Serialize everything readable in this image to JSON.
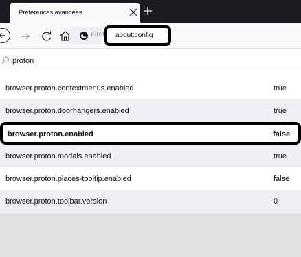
{
  "tab": {
    "title": "Préférences avancées"
  },
  "toolbar": {
    "identity_label": "Firefox",
    "url": "about:config"
  },
  "search": {
    "value": "proton",
    "icon": "search-icon"
  },
  "prefs": [
    {
      "name": "browser.proton.contextmenus.enabled",
      "value": "true",
      "modified": false
    },
    {
      "name": "browser.proton.doorhangers.enabled",
      "value": "true",
      "modified": false
    },
    {
      "name": "browser.proton.enabled",
      "value": "false",
      "modified": true
    },
    {
      "name": "browser.proton.modals.enabled",
      "value": "true",
      "modified": false
    },
    {
      "name": "browser.proton.places-tooltip.enabled",
      "value": "false",
      "modified": false
    },
    {
      "name": "browser.proton.toolbar.version",
      "value": "0",
      "modified": false
    }
  ],
  "colors": {
    "tabstrip": "#1c1b22",
    "toolbar": "#f9f9fb",
    "row_alt": "#f0f0f4",
    "highlight_border": "#000000"
  }
}
